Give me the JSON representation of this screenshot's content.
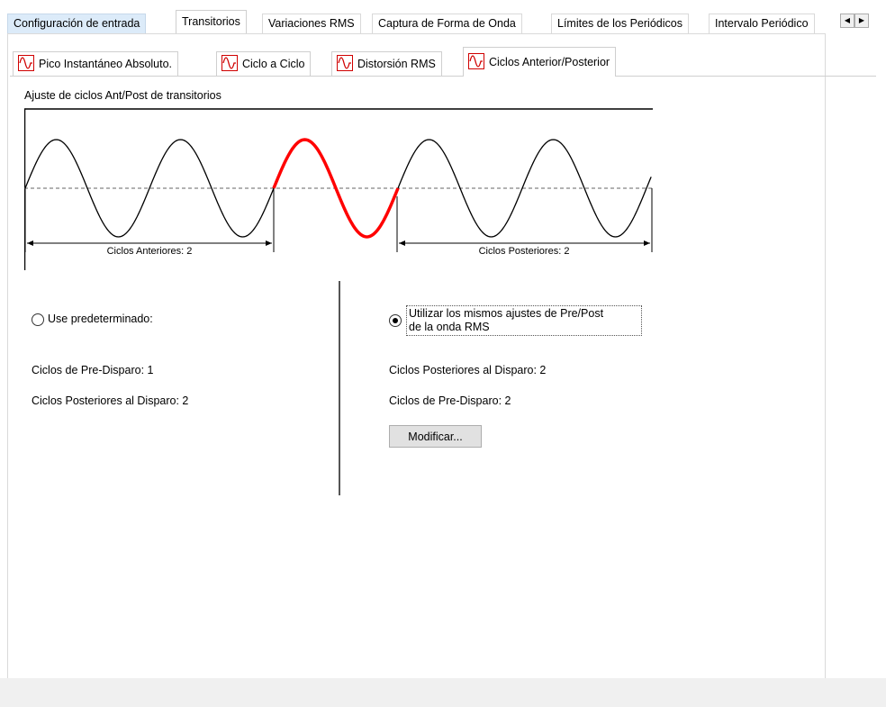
{
  "top_tabs": [
    {
      "label": "Configuración de entrada"
    },
    {
      "label": "Transitorios"
    },
    {
      "label": "Variaciones RMS"
    },
    {
      "label": "Captura de Forma de Onda"
    },
    {
      "label": "Límites de los Periódicos"
    },
    {
      "label": "Intervalo Periódico"
    }
  ],
  "top_tabs_active": "Transitorios",
  "scroll": {
    "left": "◀",
    "right": "▶"
  },
  "sub_tabs": [
    {
      "label": "Pico Instantáneo Absoluto.",
      "icon": "waveform-icon"
    },
    {
      "label": "Ciclo a Ciclo",
      "icon": "waveform-icon"
    },
    {
      "label": "Distorsión RMS",
      "icon": "waveform-icon"
    },
    {
      "label": "Ciclos Anterior/Posterior",
      "icon": "waveform-icon"
    }
  ],
  "sub_tabs_active": "Ciclos Anterior/Posterior",
  "section_title": "Ajuste de ciclos Ant/Post de transitorios",
  "chart_data": {
    "type": "line",
    "pre_label": "Ciclos Anteriores: 2",
    "post_label": "Ciclos Posteriores: 2",
    "pre_cycles": 2,
    "trigger_cycles": 1,
    "post_cycles": 2,
    "colors": {
      "normal": "#000000",
      "trigger": "#ff0000",
      "baseline": "#666666"
    }
  },
  "left_option": {
    "label": "Use predeterminado:",
    "checked": false,
    "pre_trigger": "Ciclos de Pre-Disparo: 1",
    "post_trigger": "Ciclos Posteriores al Disparo: 2"
  },
  "right_option": {
    "label_line1": "Utilizar los mismos ajustes de Pre/Post",
    "label_line2": "de la onda RMS",
    "checked": true,
    "post_trigger": "Ciclos Posteriores al Disparo: 2",
    "pre_trigger": "Ciclos de Pre-Disparo: 2",
    "modify_button": "Modificar..."
  }
}
